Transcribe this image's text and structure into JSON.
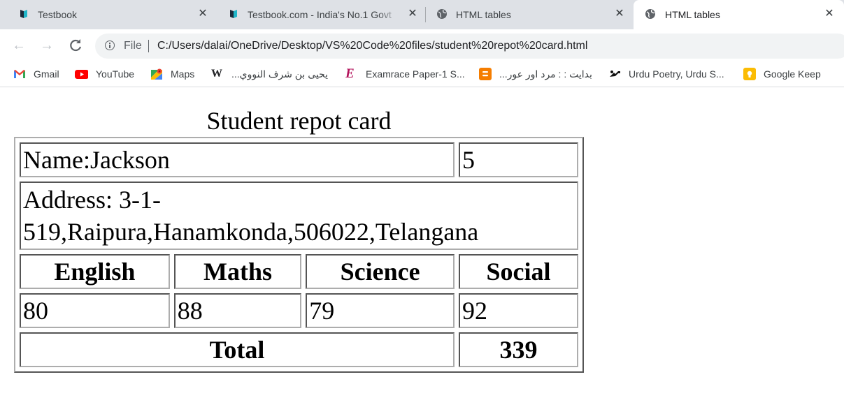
{
  "browser": {
    "tabs": [
      {
        "title": "Testbook",
        "favicon": "testbook-icon",
        "active": false
      },
      {
        "title": "Testbook.com - India's No.1 Govt",
        "favicon": "testbook-icon",
        "active": false
      },
      {
        "title": "HTML tables",
        "favicon": "globe-icon",
        "active": false
      },
      {
        "title": "HTML tables",
        "favicon": "globe-icon",
        "active": true
      }
    ],
    "address": {
      "scheme": "File",
      "url": "C:/Users/dalai/OneDrive/Desktop/VS%20Code%20files/student%20repot%20card.html"
    },
    "bookmarks": [
      {
        "label": "Gmail",
        "icon": "gmail-icon"
      },
      {
        "label": "YouTube",
        "icon": "youtube-icon"
      },
      {
        "label": "Maps",
        "icon": "maps-icon"
      },
      {
        "label": "يحيى بن شرف النووي...",
        "icon": "wikipedia-icon"
      },
      {
        "label": "Examrace Paper-1 S...",
        "icon": "examrace-icon"
      },
      {
        "label": "بدایت : : مرد اور عور...",
        "icon": "blogger-icon"
      },
      {
        "label": "Urdu Poetry, Urdu S...",
        "icon": "rekhta-icon"
      },
      {
        "label": "Google Keep",
        "icon": "keep-icon"
      }
    ]
  },
  "page": {
    "title": "Student repot card",
    "name": "Name:Jackson",
    "class_value": "5",
    "address": "Address: 3-1-519,Raipura,Hanamkonda,506022,Telangana",
    "subjects": [
      "English",
      "Maths",
      "Science",
      "Social"
    ],
    "marks": [
      "80",
      "88",
      "79",
      "92"
    ],
    "total_label": "Total",
    "total_value": "339"
  }
}
